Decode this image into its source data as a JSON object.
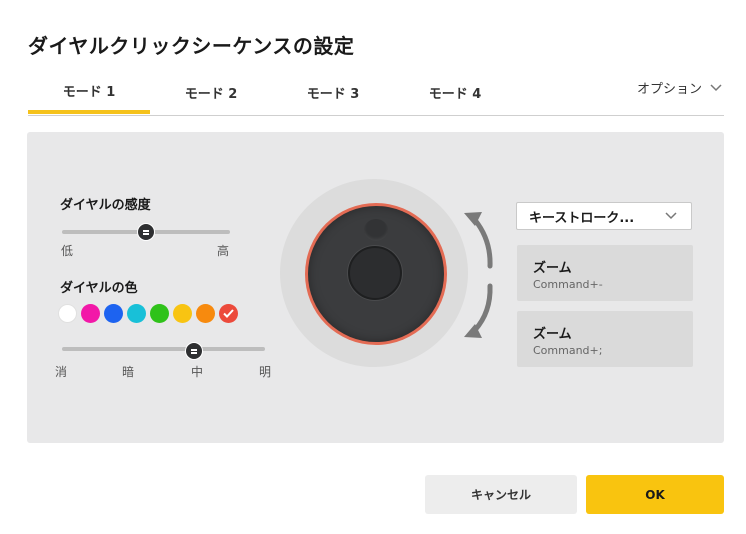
{
  "dialog": {
    "title": "ダイヤルクリックシーケンスの設定"
  },
  "tabs": [
    {
      "label": "モード 1",
      "active": true
    },
    {
      "label": "モード 2",
      "active": false
    },
    {
      "label": "モード 3",
      "active": false
    },
    {
      "label": "モード 4",
      "active": false
    }
  ],
  "options": {
    "label": "オプション",
    "icon": "chevron-down-icon"
  },
  "sensitivity": {
    "label": "ダイヤルの感度",
    "min_label": "低",
    "max_label": "高",
    "value_fraction": 0.5
  },
  "color": {
    "label": "ダイヤルの色",
    "swatches": [
      "#ffffff",
      "#f218a8",
      "#1d63f0",
      "#18c0d8",
      "#2fc21a",
      "#f8c412",
      "#f78a0e",
      "#ec4a3b"
    ],
    "selected_index": 7,
    "brightness": {
      "labels": [
        "消",
        "暗",
        "中",
        "明"
      ],
      "value_fraction": 0.65
    }
  },
  "dial": {
    "ring_color": "#e36b54",
    "body_color": "#3b3c3e"
  },
  "action": {
    "dropdown_value": "キーストローク...",
    "cards": [
      {
        "title": "ズーム",
        "shortcut": "Command+-"
      },
      {
        "title": "ズーム",
        "shortcut": "Command+;"
      }
    ]
  },
  "footer": {
    "cancel_label": "キャンセル",
    "ok_label": "OK"
  },
  "colors": {
    "accent": "#f9c40f",
    "panel": "#e8e8e9"
  }
}
